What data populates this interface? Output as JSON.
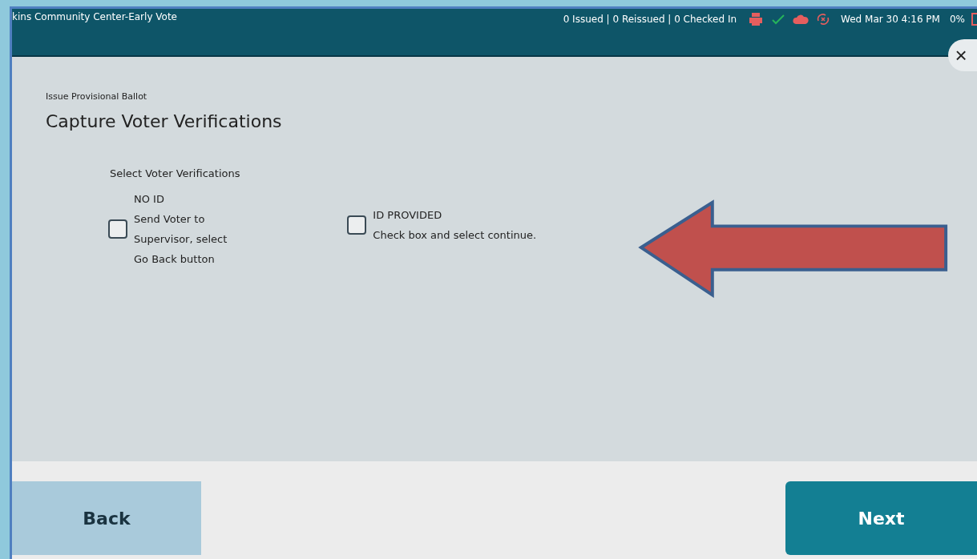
{
  "header": {
    "title": "kins Community Center-Early Vote",
    "counts": "0 Issued | 0 Reissued | 0 Checked In",
    "datetime": "Wed Mar 30  4:16 PM",
    "battery": "0%"
  },
  "close": {
    "label": "×"
  },
  "breadcrumb": "Issue Provisional Ballot",
  "heading": "Capture Voter Verifications",
  "section_label": "Select Voter Verifications",
  "options": [
    {
      "checked": false,
      "lines": [
        "NO ID",
        "Send Voter to",
        "Supervisor, select",
        "Go Back button"
      ]
    },
    {
      "checked": false,
      "lines": [
        "ID PROVIDED",
        "Check box and select continue."
      ]
    }
  ],
  "buttons": [
    {
      "kind": "back",
      "label": "Back"
    },
    {
      "kind": "next",
      "label": "Next"
    }
  ]
}
